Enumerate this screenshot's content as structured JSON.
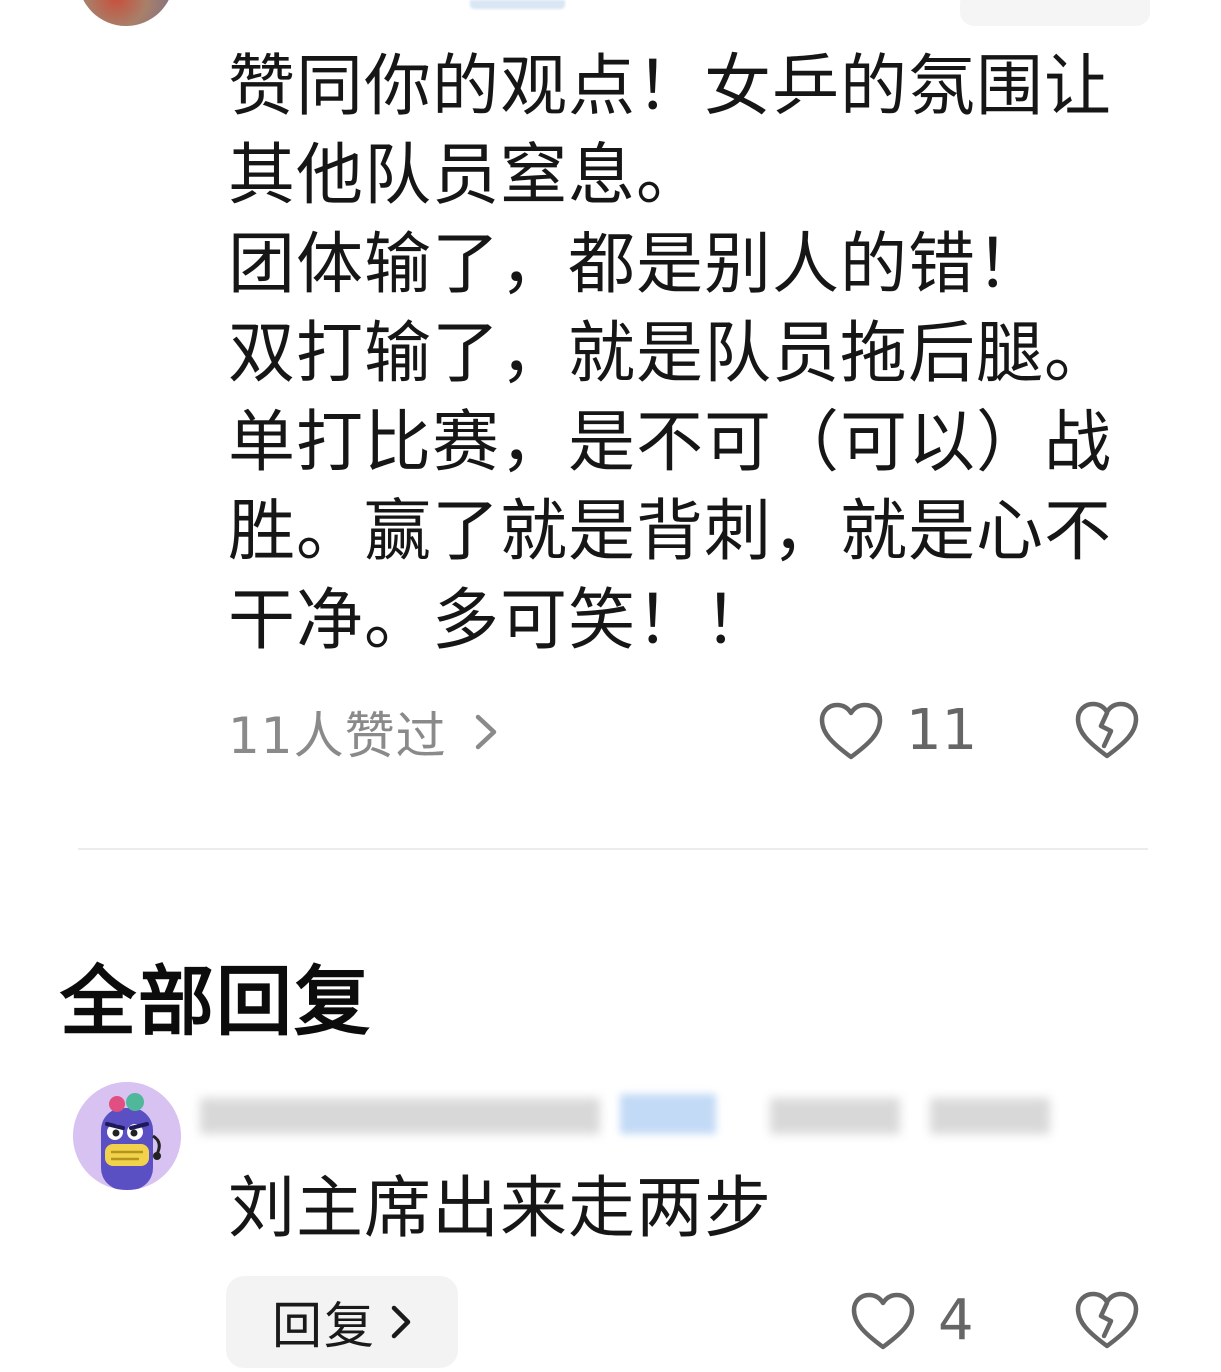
{
  "main_comment": {
    "text": "赞同你的观点！女乒的氛围让\n其他队员窒息。\n团体输了，都是别人的错！\n双打输了，就是队员拖后腿。\n单打比赛，是不可（可以）战\n胜。赢了就是背刺，就是心不\n干净。多可笑！！",
    "likers_label": "11人赞过",
    "like_count": "11"
  },
  "replies_section": {
    "title": "全部回复"
  },
  "replies": [
    {
      "text": "刘主席出来走两步",
      "reply_button_label": "回复",
      "like_count": "4"
    }
  ],
  "icons": {
    "like": "heart-outline-icon",
    "dislike": "broken-heart-icon",
    "chevron": "chevron-right-icon"
  },
  "colors": {
    "text_primary": "#161616",
    "text_secondary": "#8a8a8a",
    "icon_gray": "#666666",
    "divider": "#ececec",
    "button_bg": "#f3f3f3"
  }
}
